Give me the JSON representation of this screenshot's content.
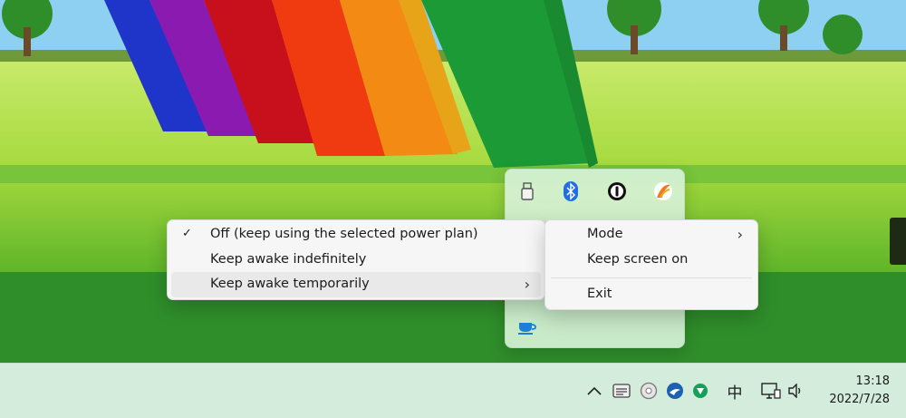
{
  "menu_left": {
    "items": [
      {
        "label": "Off (keep using the selected power plan)",
        "checked": true
      },
      {
        "label": "Keep awake indefinitely"
      },
      {
        "label": "Keep awake temporarily",
        "has_submenu": true
      }
    ]
  },
  "menu_right": {
    "items": [
      {
        "label": "Mode",
        "has_submenu": true
      },
      {
        "label": "Keep screen on"
      },
      {
        "label": "Exit"
      }
    ]
  },
  "tray_flyout": {
    "icons": [
      "usb-drive-icon",
      "bluetooth-icon",
      "onepassword-icon",
      "app-orange-icon",
      "awake-coffee-icon"
    ]
  },
  "taskbar": {
    "ime_label": "中",
    "time": "13:18",
    "date": "2022/7/28",
    "icons": [
      "chevron-up-icon",
      "tray-app-icon",
      "disc-icon",
      "bird-app-icon",
      "green-app-icon",
      "monitor-icon",
      "speaker-icon"
    ]
  },
  "colors": {
    "taskbar_bg": "#d3ecdc",
    "menu_bg": "#f6f6f6",
    "menu_highlight": "#e9e9e9",
    "flyout_bg": "#d6f2d6"
  }
}
